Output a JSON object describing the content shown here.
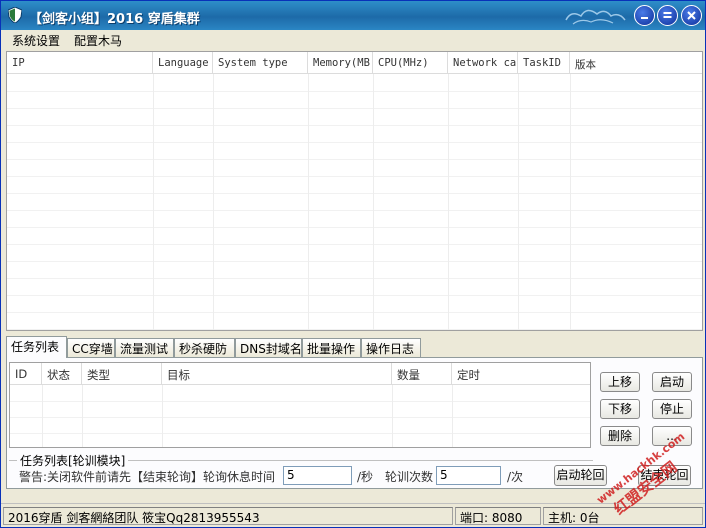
{
  "window": {
    "title": "【剑客小组】2016 穿盾集群"
  },
  "menu": {
    "items": [
      "系统设置",
      "配置木马"
    ]
  },
  "hosts_table": {
    "columns": [
      "IP",
      "Language",
      "System type",
      "Memory(MB",
      "CPU(MHz)",
      "Network ca",
      "TaskID",
      "版本"
    ],
    "rows": []
  },
  "tabs": [
    "任务列表",
    "CC穿墙",
    "流量测试",
    "秒杀硬防",
    "DNS封域名",
    "批量操作",
    "操作日志"
  ],
  "active_tab": 0,
  "task_table": {
    "columns": [
      "ID",
      "状态",
      "类型",
      "目标",
      "数量",
      "定时"
    ],
    "rows": []
  },
  "side_buttons": {
    "up": "上移",
    "start": "启动",
    "down": "下移",
    "stop": "停止",
    "delete": "删除",
    "third_right": "..."
  },
  "poll_module": {
    "legend": "任务列表[轮训模块]",
    "warning": "警告:关闭软件前请先【结束轮询】轮询休息时间",
    "rest_time": "5",
    "rest_unit": "/秒",
    "count_label": "轮训次数",
    "count": "5",
    "count_unit": "/次",
    "start_button": "启动轮回",
    "stop_button": "结束轮回"
  },
  "status": {
    "team": "2016穿盾 剑客網絡团队 筱宝Qq2813955543",
    "port_label": "端口:",
    "port": "8080",
    "hosts_label": "主机:",
    "hosts": "0台"
  },
  "watermark": {
    "lines": [
      "www.hackhk.com",
      "红盟安全网"
    ],
    "color": "#d02020"
  },
  "colors": {
    "titlebar": "#1d6aa8",
    "window_border": "#0831b8",
    "chrome": "#ece9d8"
  }
}
